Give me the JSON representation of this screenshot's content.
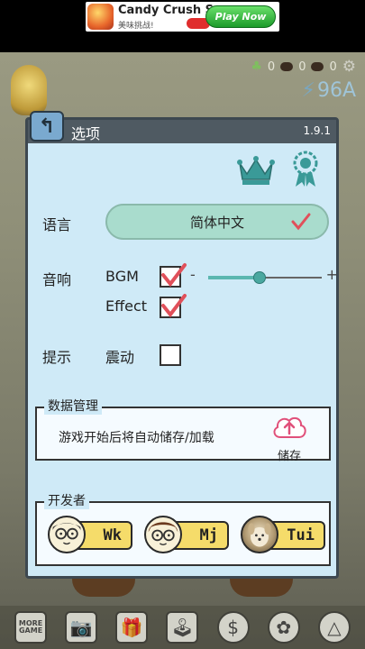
{
  "ad": {
    "title": "Candy Crush Saga",
    "subtitle": "美味挑战!",
    "cta": "Play Now"
  },
  "status": {
    "sprouts": "0",
    "beans": "0",
    "seeds": "0",
    "energy": "96A"
  },
  "panel": {
    "title": "选项",
    "version": "1.9.1",
    "language": {
      "label": "语言",
      "value": "简体中文",
      "checked": true
    },
    "sound": {
      "label": "音响",
      "bgm_label": "BGM",
      "bgm_enabled": true,
      "bgm_volume": 0.45,
      "minus": "-",
      "plus": "+",
      "effect_label": "Effect",
      "effect_enabled": true
    },
    "hint": {
      "label": "提示",
      "vibrate_label": "震动",
      "vibrate_enabled": false
    },
    "data": {
      "title": "数据管理",
      "text": "游戏开始后将自动储存/加载",
      "save_label": "储存"
    },
    "developers": {
      "title": "开发者",
      "members": [
        {
          "tag": "Wk"
        },
        {
          "tag": "Mj"
        },
        {
          "tag": "Tui"
        }
      ]
    }
  },
  "bottom_bar": {
    "more_label": "MORE GAME",
    "icons": [
      "more-game-icon",
      "camera-icon",
      "gift-icon",
      "joystick-icon",
      "coin-icon",
      "flower-icon",
      "triangle-icon"
    ]
  },
  "colors": {
    "panel_bg": "#cfeaf7",
    "header": "#4f5a62",
    "accent_teal": "#3a9a98",
    "check_red": "#e0505a",
    "language_button": "#a9dccd",
    "dev_tag": "#f5dc6a"
  }
}
